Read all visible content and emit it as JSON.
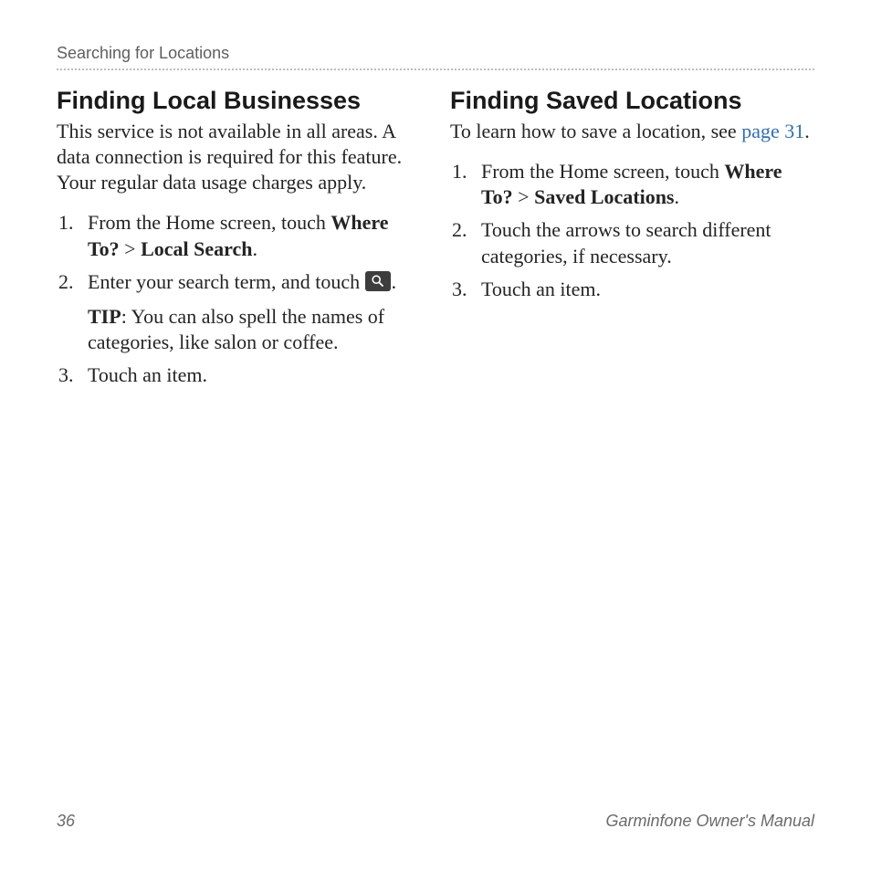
{
  "runningHead": "Searching for Locations",
  "left": {
    "heading": "Finding Local Businesses",
    "intro": "This service is not available in all areas. A data connection is required for this feature. Your regular data usage charges apply.",
    "step1_pre": "From the Home screen, touch ",
    "step1_b1": "Where To?",
    "step1_gt": " > ",
    "step1_b2": "Local Search",
    "step1_post": ".",
    "step2_pre": "Enter your search term, and touch ",
    "step2_post": ".",
    "tip_label": "TIP",
    "tip_text": ": You can also spell the names of categories, like salon or coffee.",
    "step3": "Touch an item."
  },
  "right": {
    "heading": "Finding Saved Locations",
    "intro_pre": "To learn how to save a location, see ",
    "intro_link": "page 31",
    "intro_post": ".",
    "step1_pre": "From the Home screen, touch ",
    "step1_b1": "Where To?",
    "step1_gt": " > ",
    "step1_b2": "Saved Locations",
    "step1_post": ".",
    "step2": "Touch the arrows to search different categories, if necessary.",
    "step3": "Touch an item."
  },
  "footer": {
    "pageNum": "36",
    "bookTitle": "Garminfone Owner's Manual"
  }
}
